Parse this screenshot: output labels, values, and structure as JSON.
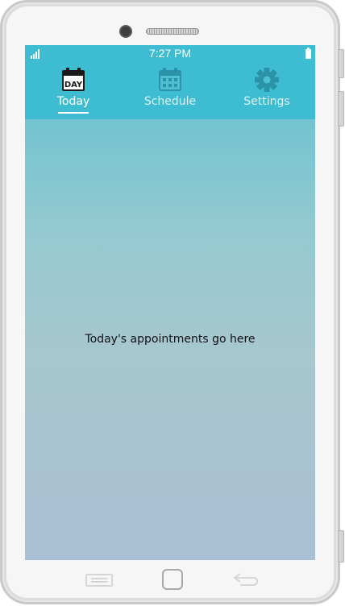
{
  "status_bar": {
    "time": "7:27 PM",
    "signal_icon": "signal-bars-icon",
    "battery_icon": "battery-icon"
  },
  "tabs": [
    {
      "label": "Today",
      "icon": "calendar-day-icon",
      "icon_text": "DAY",
      "active": true
    },
    {
      "label": "Schedule",
      "icon": "calendar-grid-icon",
      "active": false
    },
    {
      "label": "Settings",
      "icon": "gear-icon",
      "active": false
    }
  ],
  "content": {
    "message": "Today's appointments go here"
  },
  "hardware_nav": {
    "menu_icon": "menu-icon",
    "home_icon": "home-icon",
    "back_icon": "back-arrow-icon"
  },
  "colors": {
    "header": "#3ebcd1",
    "active_icon": "#1a1a1a",
    "inactive_icon": "#2a93a8",
    "text": "#111111"
  }
}
